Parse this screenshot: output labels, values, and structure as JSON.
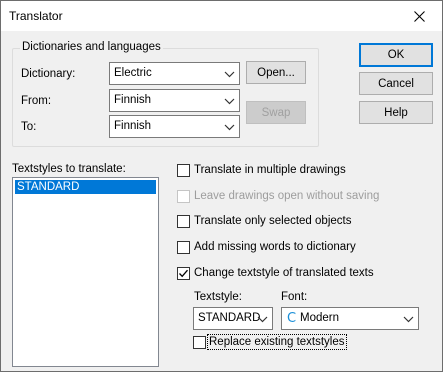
{
  "window": {
    "title": "Translator"
  },
  "group": {
    "legend": "Dictionaries and languages",
    "dictionary_label": "Dictionary:",
    "dictionary_value": "Electric",
    "from_label": "From:",
    "from_value": "Finnish",
    "to_label": "To:",
    "to_value": "Finnish",
    "open_button": "Open...",
    "swap_button": "Swap"
  },
  "buttons": {
    "ok": "OK",
    "cancel": "Cancel",
    "help": "Help"
  },
  "textstyles": {
    "label": "Textstyles to translate:",
    "items": [
      "STANDARD"
    ]
  },
  "options": {
    "translate_multiple": {
      "label": "Translate in multiple drawings",
      "checked": false
    },
    "leave_open": {
      "label": "Leave drawings open without saving",
      "checked": false,
      "disabled": true
    },
    "selected_only": {
      "label": "Translate only selected objects",
      "checked": false
    },
    "add_missing": {
      "label": "Add missing words to dictionary",
      "checked": false
    },
    "change_style": {
      "label": "Change textstyle of translated texts",
      "checked": true
    },
    "replace_existing": {
      "label": "Replace existing textstyles",
      "checked": false
    }
  },
  "style_select": {
    "textstyle_label": "Textstyle:",
    "textstyle_value": "STANDARD",
    "font_label": "Font:",
    "font_value": "Modern",
    "font_icon_glyph": "C"
  },
  "icons": {
    "close": "close-icon",
    "dropdown": "chevron-down-icon",
    "checkmark": "checkmark-icon",
    "font": "font-type-icon"
  }
}
